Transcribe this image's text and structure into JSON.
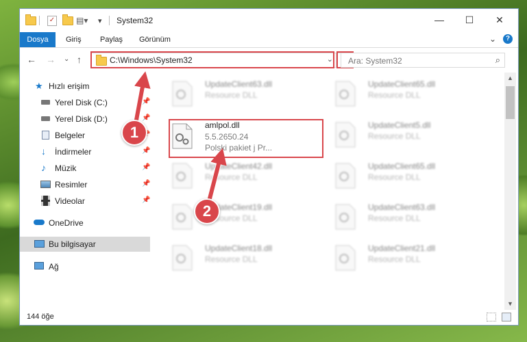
{
  "window": {
    "title": "System32",
    "controls": {
      "minimize": "—",
      "maximize": "☐",
      "close": "✕"
    }
  },
  "ribbon": {
    "tabs": [
      "Dosya",
      "Giriş",
      "Paylaş",
      "Görünüm"
    ]
  },
  "nav": {
    "address": "C:\\Windows\\System32",
    "search_placeholder": "Ara: System32"
  },
  "sidebar": {
    "items": [
      {
        "label": "Hızlı erişim",
        "icon": "star-icon"
      },
      {
        "label": "Yerel Disk (C:)",
        "icon": "drive-icon",
        "pinned": true
      },
      {
        "label": "Yerel Disk (D:)",
        "icon": "drive-icon",
        "pinned": true
      },
      {
        "label": "Belgeler",
        "icon": "documents-icon",
        "pinned": true
      },
      {
        "label": "İndirmeler",
        "icon": "download-icon",
        "pinned": true
      },
      {
        "label": "Müzik",
        "icon": "music-icon",
        "pinned": true
      },
      {
        "label": "Resimler",
        "icon": "pictures-icon",
        "pinned": true
      },
      {
        "label": "Videolar",
        "icon": "videos-icon",
        "pinned": true
      },
      {
        "label": "OneDrive",
        "icon": "cloud-icon"
      },
      {
        "label": "Bu bilgisayar",
        "icon": "computer-icon",
        "selected": true
      },
      {
        "label": "Ağ",
        "icon": "network-icon"
      }
    ]
  },
  "files": {
    "focused": {
      "name": "amlpol.dll",
      "version": "5.5.2650.24",
      "description": "Polski pakiet j   Pr..."
    },
    "col1": [
      {
        "name": "UpdateClient63.dll",
        "type": "Resource DLL"
      },
      {
        "name": "UpdateClient42.dll",
        "type": "Resource DLL"
      },
      {
        "name": "UpdateClient19.dll",
        "type": "Resource DLL"
      },
      {
        "name": "UpdateClient18.dll",
        "type": "Resource DLL"
      }
    ],
    "col2": [
      {
        "name": "UpdateClient65.dll",
        "type": "Resource DLL"
      },
      {
        "name": "UpdateClient5.dll",
        "type": "Resource DLL"
      },
      {
        "name": "UpdateClient65.dll",
        "type": "Resource DLL"
      },
      {
        "name": "UpdateClient63.dll",
        "type": "Resource DLL"
      },
      {
        "name": "UpdateClient21.dll",
        "type": "Resource DLL"
      }
    ]
  },
  "status": {
    "count": "144 öğe"
  },
  "annotations": {
    "step1": "1",
    "step2": "2",
    "color": "#d9464b"
  }
}
